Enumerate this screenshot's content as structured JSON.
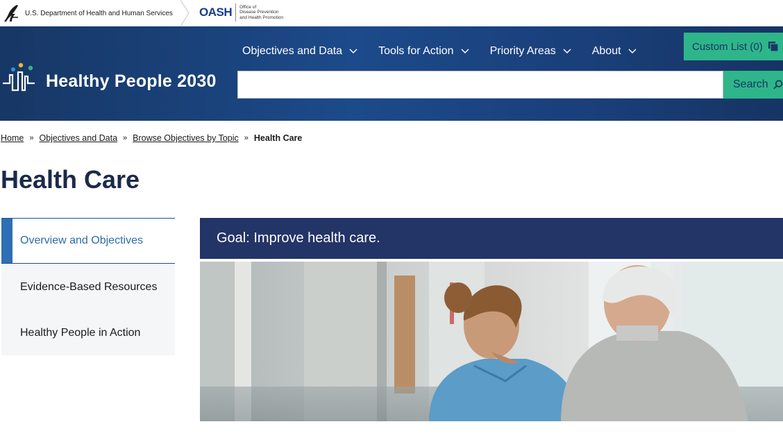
{
  "agency": {
    "hhs_text": "U.S. Department of Health and Human Services",
    "oash_word": "OASH",
    "oash_sub_1": "Office of",
    "oash_sub_2": "Disease Prevention",
    "oash_sub_3": "and Health Promotion"
  },
  "site": {
    "title": "Healthy People 2030"
  },
  "nav": {
    "items": [
      {
        "label": "Objectives and Data"
      },
      {
        "label": "Tools for Action"
      },
      {
        "label": "Priority Areas"
      },
      {
        "label": "About"
      }
    ]
  },
  "custom_list": {
    "label": "Custom List (0)"
  },
  "search": {
    "value": "",
    "placeholder": "",
    "button_label": "Search"
  },
  "breadcrumb": {
    "items": [
      "Home",
      "Objectives and Data",
      "Browse Objectives by Topic"
    ],
    "current": "Health Care"
  },
  "page": {
    "title": "Health Care",
    "goal": "Goal: Improve health care."
  },
  "sidenav": {
    "items": [
      {
        "label": "Overview and Objectives",
        "active": true
      },
      {
        "label": "Evidence-Based Resources",
        "active": false
      },
      {
        "label": "Healthy People in Action",
        "active": false
      }
    ]
  },
  "colors": {
    "header_navy": "#173765",
    "accent_green": "#2fb58a",
    "goal_bar": "#233466",
    "active_blue": "#2e6eb5"
  },
  "icons": [
    "hhs-eagle-icon",
    "chevron-down-icon",
    "copy-icon",
    "search-icon",
    "healthy-people-logo-icon"
  ]
}
